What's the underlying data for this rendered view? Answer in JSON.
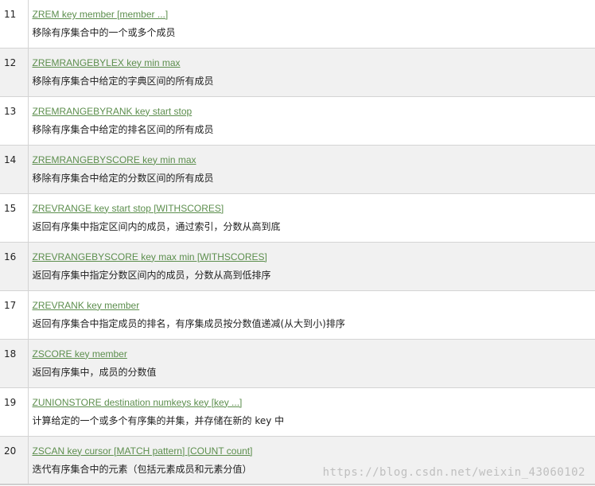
{
  "commands": [
    {
      "num": "11",
      "command": "ZREM key member [member ...]",
      "description": "移除有序集合中的一个或多个成员"
    },
    {
      "num": "12",
      "command": "ZREMRANGEBYLEX key min max",
      "description": "移除有序集合中给定的字典区间的所有成员"
    },
    {
      "num": "13",
      "command": "ZREMRANGEBYRANK key start stop",
      "description": "移除有序集合中给定的排名区间的所有成员"
    },
    {
      "num": "14",
      "command": "ZREMRANGEBYSCORE key min max",
      "description": "移除有序集合中给定的分数区间的所有成员"
    },
    {
      "num": "15",
      "command": "ZREVRANGE key start stop [WITHSCORES]",
      "description": "返回有序集中指定区间内的成员，通过索引，分数从高到底"
    },
    {
      "num": "16",
      "command": "ZREVRANGEBYSCORE key max min [WITHSCORES]",
      "description": "返回有序集中指定分数区间内的成员，分数从高到低排序"
    },
    {
      "num": "17",
      "command": "ZREVRANK key member",
      "description": "返回有序集合中指定成员的排名，有序集成员按分数值递减(从大到小)排序"
    },
    {
      "num": "18",
      "command": "ZSCORE key member",
      "description": "返回有序集中，成员的分数值"
    },
    {
      "num": "19",
      "command": "ZUNIONSTORE destination numkeys key [key ...]",
      "description": "计算给定的一个或多个有序集的并集，并存储在新的 key 中"
    },
    {
      "num": "20",
      "command": "ZSCAN key cursor [MATCH pattern] [COUNT count]",
      "description": "迭代有序集合中的元素（包括元素成员和元素分值）"
    }
  ],
  "watermark": "https://blog.csdn.net/weixin_43060102",
  "colors": {
    "link": "#5c8e4d",
    "row_alt": "#f1f1f1",
    "border": "#d4d4d4"
  }
}
